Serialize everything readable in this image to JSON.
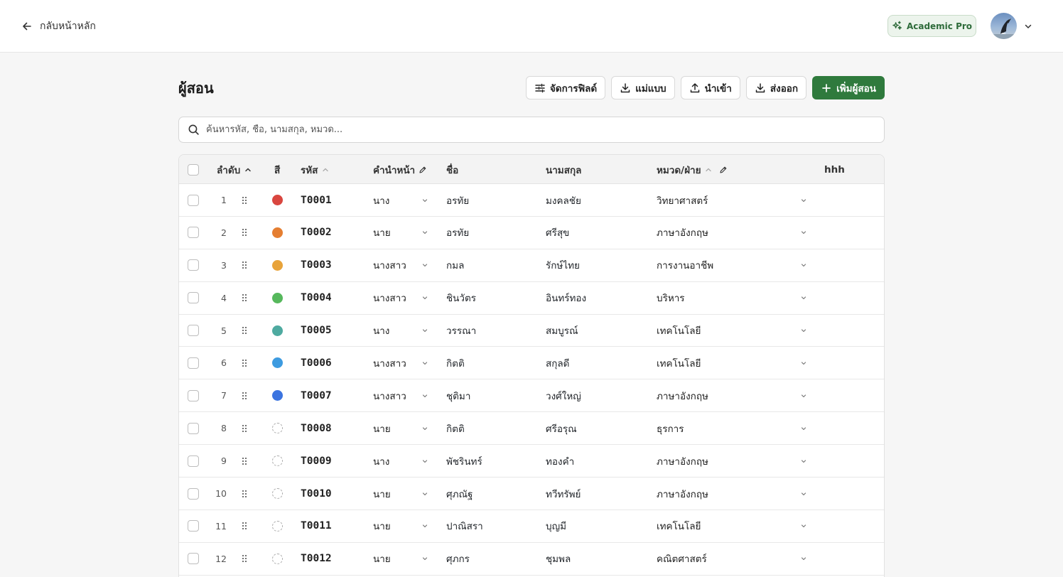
{
  "nav": {
    "back_label": "กลับหน้าหลัก",
    "plan_badge": "Academic Pro"
  },
  "page": {
    "title": "ผู้สอน"
  },
  "toolbar": {
    "manage_fields": "จัดการฟิลด์",
    "template": "แม่แบบ",
    "import": "นำเข้า",
    "export": "ส่งออก",
    "add_teacher": "เพิ่มผู้สอน"
  },
  "search": {
    "placeholder": "ค้นหารหัส, ชื่อ, นามสกุล, หมวด..."
  },
  "table": {
    "headers": {
      "order": "ลำดับ",
      "color": "สี",
      "code": "รหัส",
      "prefix": "คำนำหน้า",
      "first_name": "ชื่อ",
      "last_name": "นามสกุล",
      "department": "หมวด/ฝ่าย",
      "custom": "hhh"
    },
    "rows": [
      {
        "order": "1",
        "color": "#d9463f",
        "code": "T0001",
        "prefix": "นาง",
        "first_name": "อรทัย",
        "last_name": "มงคลชัย",
        "department": "วิทยาศาสตร์"
      },
      {
        "order": "2",
        "color": "#e57e31",
        "code": "T0002",
        "prefix": "นาย",
        "first_name": "อรทัย",
        "last_name": "ศรีสุข",
        "department": "ภาษาอังกฤษ"
      },
      {
        "order": "3",
        "color": "#e8a33a",
        "code": "T0003",
        "prefix": "นางสาว",
        "first_name": "กมล",
        "last_name": "รักษ์ไทย",
        "department": "การงานอาชีพ"
      },
      {
        "order": "4",
        "color": "#56b85c",
        "code": "T0004",
        "prefix": "นางสาว",
        "first_name": "ชินวัตร",
        "last_name": "อินทร์ทอง",
        "department": "บริหาร"
      },
      {
        "order": "5",
        "color": "#4eaaa0",
        "code": "T0005",
        "prefix": "นาง",
        "first_name": "วรรณา",
        "last_name": "สมบูรณ์",
        "department": "เทคโนโลยี"
      },
      {
        "order": "6",
        "color": "#3d9be0",
        "code": "T0006",
        "prefix": "นางสาว",
        "first_name": "กิตติ",
        "last_name": "สกุลดี",
        "department": "เทคโนโลยี"
      },
      {
        "order": "7",
        "color": "#3b74e0",
        "code": "T0007",
        "prefix": "นางสาว",
        "first_name": "ชุติมา",
        "last_name": "วงศ์ใหญ่",
        "department": "ภาษาอังกฤษ"
      },
      {
        "order": "8",
        "color": "",
        "code": "T0008",
        "prefix": "นาย",
        "first_name": "กิตติ",
        "last_name": "ศรีอรุณ",
        "department": "ธุรการ"
      },
      {
        "order": "9",
        "color": "",
        "code": "T0009",
        "prefix": "นาง",
        "first_name": "พัชรินทร์",
        "last_name": "ทองคำ",
        "department": "ภาษาอังกฤษ"
      },
      {
        "order": "10",
        "color": "",
        "code": "T0010",
        "prefix": "นาย",
        "first_name": "ศุภณัฐ",
        "last_name": "ทวีทรัพย์",
        "department": "ภาษาอังกฤษ"
      },
      {
        "order": "11",
        "color": "",
        "code": "T0011",
        "prefix": "นาย",
        "first_name": "ปาณิสรา",
        "last_name": "บุญมี",
        "department": "เทคโนโลยี"
      },
      {
        "order": "12",
        "color": "",
        "code": "T0012",
        "prefix": "นาย",
        "first_name": "ศุภกร",
        "last_name": "ชุมพล",
        "department": "คณิตศาสตร์"
      }
    ]
  },
  "colors": {
    "primary": "#2f7a3d",
    "badge_bg": "#ecf4ec"
  }
}
